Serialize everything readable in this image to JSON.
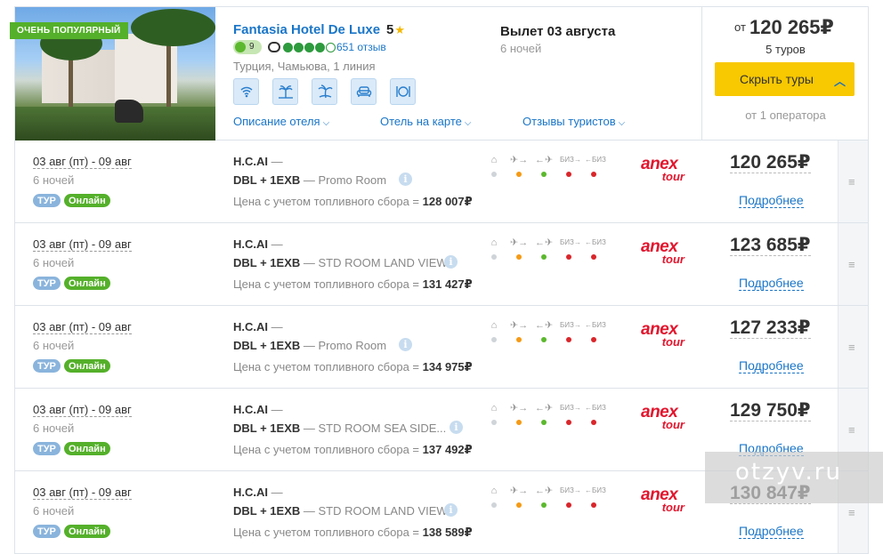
{
  "hotel": {
    "badge": "ОЧЕНЬ ПОПУЛЯРНЫЙ",
    "name": "Fantasia Hotel De Luxe",
    "stars": "5",
    "rating": "9",
    "reviews": "651 отзыв",
    "location": "Турция, Чамьюва, 1 линия",
    "amenities": [
      "wifi-icon",
      "beach-icon",
      "palm-icon",
      "armchair-icon",
      "restaurant-icon"
    ],
    "links": [
      "Описание отеля",
      "Отель на карте",
      "Отзывы туристов"
    ]
  },
  "departure": {
    "label": "Вылет 03 августа",
    "nights": "6 ночей"
  },
  "summary": {
    "from": "от",
    "price": "120 265₽",
    "tours": "5 туров",
    "button": "Скрыть туры",
    "operators": "от 1 оператора"
  },
  "service_icons": [
    "home-icon",
    "flight-there-icon",
    "flight-back-icon",
    "business-there-icon",
    "business-back-icon"
  ],
  "service_labels": {
    "biz": "БИЗ"
  },
  "colors": {
    "grey": "#cfd4d9",
    "orange": "#f59a14",
    "green": "#5cb82e",
    "red": "#d9262b"
  },
  "rows": [
    {
      "dates": "03 авг (пт) - 09 авг",
      "nights": "6 ночей",
      "badge1": "ТУР",
      "badge2": "Онлайн",
      "meal": "H.C.AI",
      "dash": " —",
      "room": "DBL + 1EXB",
      "room_desc": " — Promo Room",
      "fuel_label": "Цена с учетом топливного сбора = ",
      "fuel_price": "128 007₽",
      "operator_a": "anex",
      "operator_b": "tour",
      "price": "120 265₽",
      "more": "Подробнее"
    },
    {
      "dates": "03 авг (пт) - 09 авг",
      "nights": "6 ночей",
      "badge1": "ТУР",
      "badge2": "Онлайн",
      "meal": "H.C.AI",
      "dash": " —",
      "room": "DBL + 1EXB",
      "room_desc": " — STD ROOM LAND VIEW",
      "fuel_label": "Цена с учетом топливного сбора = ",
      "fuel_price": "131 427₽",
      "operator_a": "anex",
      "operator_b": "tour",
      "price": "123 685₽",
      "more": "Подробнее"
    },
    {
      "dates": "03 авг (пт) - 09 авг",
      "nights": "6 ночей",
      "badge1": "ТУР",
      "badge2": "Онлайн",
      "meal": "H.C.AI",
      "dash": " —",
      "room": "DBL + 1EXB",
      "room_desc": " — Promo Room",
      "fuel_label": "Цена с учетом топливного сбора = ",
      "fuel_price": "134 975₽",
      "operator_a": "anex",
      "operator_b": "tour",
      "price": "127 233₽",
      "more": "Подробнее"
    },
    {
      "dates": "03 авг (пт) - 09 авг",
      "nights": "6 ночей",
      "badge1": "ТУР",
      "badge2": "Онлайн",
      "meal": "H.C.AI",
      "dash": " —",
      "room": "DBL + 1EXB",
      "room_desc": " — STD ROOM SEA SIDE...",
      "fuel_label": "Цена с учетом топливного сбора = ",
      "fuel_price": "137 492₽",
      "operator_a": "anex",
      "operator_b": "tour",
      "price": "129 750₽",
      "more": "Подробнее"
    },
    {
      "dates": "03 авг (пт) - 09 авг",
      "nights": "6 ночей",
      "badge1": "ТУР",
      "badge2": "Онлайн",
      "meal": "H.C.AI",
      "dash": " —",
      "room": "DBL + 1EXB",
      "room_desc": " — STD ROOM LAND VIEW",
      "fuel_label": "Цена с учетом топливного сбора = ",
      "fuel_price": "138 589₽",
      "operator_a": "anex",
      "operator_b": "tour",
      "price": "130 847₽",
      "more": "Подробнее"
    }
  ],
  "watermark": "otzyv.ru"
}
